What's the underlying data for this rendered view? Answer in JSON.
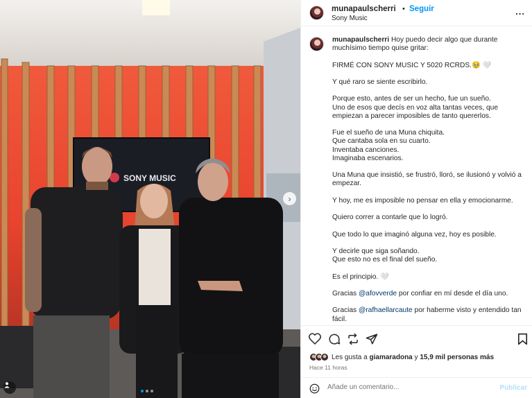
{
  "post": {
    "username": "munapaulscherri",
    "separator": "•",
    "follow_label": "Seguir",
    "location": "Sony Music",
    "more_glyph": "..."
  },
  "photo": {
    "screen_text": "SONY MUSIC",
    "icons": {
      "next": "chevron-right-icon",
      "tag": "person-icon"
    },
    "carousel": {
      "count": 3,
      "active": 1
    }
  },
  "caption": {
    "username": "munapaulscherri",
    "line1": "Hoy puedo decir algo que durante muchísimo tiempo quise gritar:",
    "p1": "FIRMÉ CON SONY MUSIC Y 5020 RCRDS.🥹 🤍",
    "p2": "Y qué raro se siente escribirlo.",
    "p3a": "Porque esto, antes de ser un hecho, fue un sueño.",
    "p3b": "Uno de esos que decís en voz alta tantas veces, que empiezan a parecer imposibles de tanto quererlos.",
    "p4a": "Fue el sueño de una Muna chiquita.",
    "p4b": "Que cantaba sola en su cuarto.",
    "p4c": "Inventaba canciones.",
    "p4d": "Imaginaba escenarios.",
    "p5": "Una Muna que insistió, se frustró, lloró, se ilusionó y volvió a empezar.",
    "p6": "Y hoy, me es imposible no pensar en ella y emocionarme.",
    "p7": "Quiero correr a contarle que lo logró.",
    "p8": "Que todo lo que imaginó alguna vez, hoy es posible.",
    "p9a": "Y decirle que siga soñando.",
    "p9b": "Que esto no es el final del sueño.",
    "p10": "Es el principio. 🤍",
    "p11_pre": "Gracias",
    "p11_mention": "@afovverde",
    "p11_post": "por confiar en mí desde el día uno.",
    "p12_pre": "Gracias",
    "p12_mention": "@rafhaellarcaute",
    "p12_post": "por haberme visto y entendido tan fácil."
  },
  "actions": {
    "icons": [
      "heart-icon",
      "comment-icon",
      "share-icon",
      "send-icon",
      "bookmark-icon"
    ]
  },
  "likes": {
    "prefix": "Les gusta a",
    "user": "giamaradona",
    "conj": "y",
    "count": "15,9 mil personas más"
  },
  "time": "Hace 11 horas",
  "comment": {
    "placeholder": "Añade un comentario...",
    "publish_label": "Publicar"
  },
  "colors": {
    "accent": "#0095f6",
    "publish_disabled": "#b2dffc",
    "mention": "#00376b",
    "wall_red": "#e8432e"
  }
}
